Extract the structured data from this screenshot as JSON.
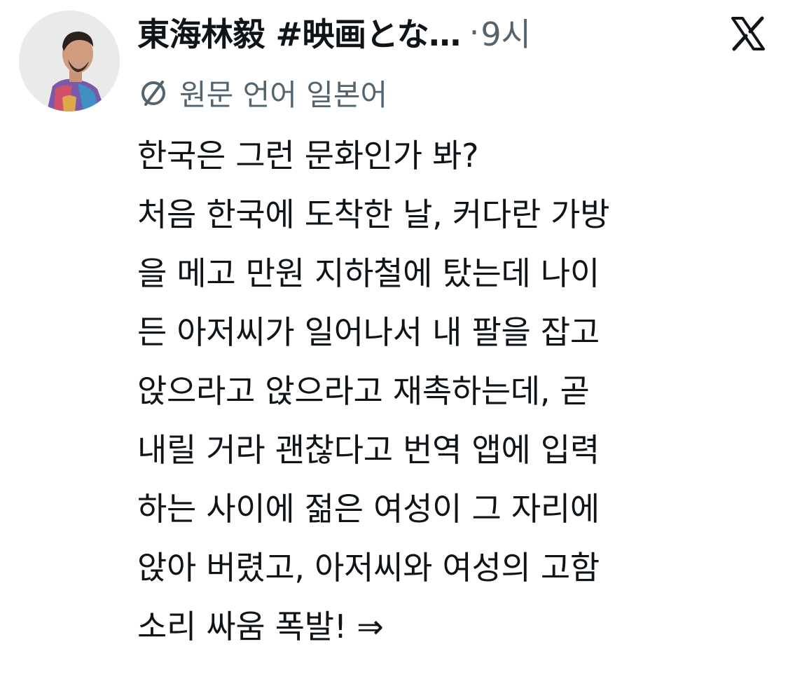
{
  "tweet": {
    "author": {
      "display_name": "東海林毅 #映画とな…",
      "avatar_icon": "user-avatar-photo"
    },
    "separator": "·",
    "timestamp": "9시",
    "source_icon": "x-logo-icon",
    "translation": {
      "icon": "translate-icon",
      "label": "원문 언어 일본어"
    },
    "body_lines": [
      "한국은 그런 문화인가 봐?",
      "처음 한국에 도착한 날, 커다란 가방",
      "을 메고 만원 지하철에 탔는데 나이",
      "든 아저씨가 일어나서 내 팔을 잡고",
      "앉으라고 앉으라고 재촉하는데, 곧",
      "내릴 거라 괜찮다고 번역 앱에 입력",
      "하는 사이에 젊은 여성이 그 자리에",
      "앉아 버렸고, 아저씨와 여성의 고함",
      "소리 싸움 폭발! ⇒"
    ]
  },
  "colors": {
    "text_primary": "#0f1419",
    "text_secondary": "#536471",
    "background": "#ffffff"
  }
}
